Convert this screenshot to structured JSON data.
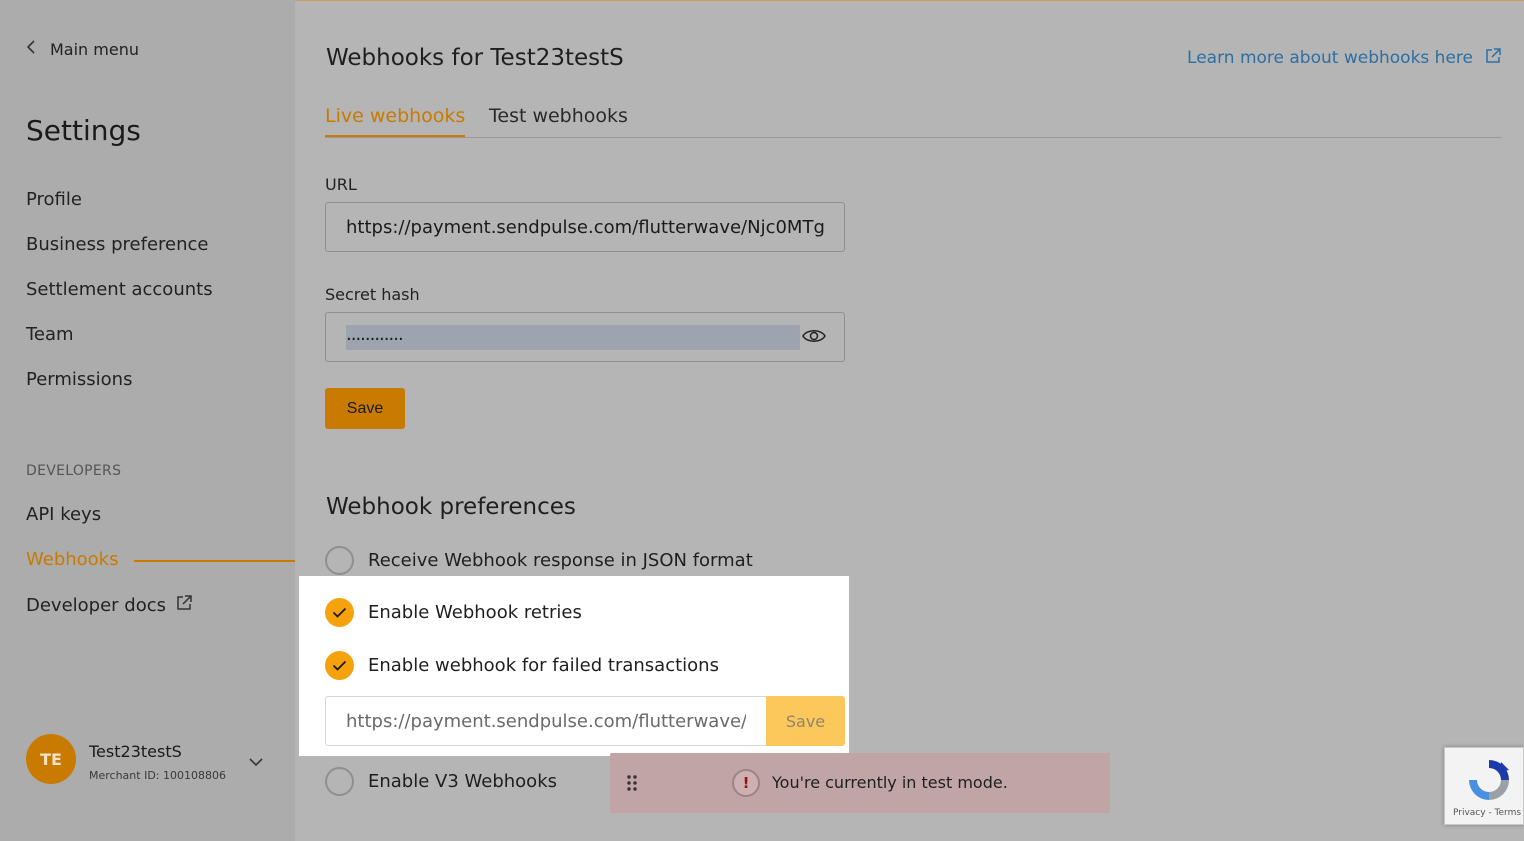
{
  "sidebar": {
    "back_label": "Main menu",
    "title": "Settings",
    "items": [
      {
        "label": "Profile"
      },
      {
        "label": "Business preference"
      },
      {
        "label": "Settlement accounts"
      },
      {
        "label": "Team"
      },
      {
        "label": "Permissions"
      }
    ],
    "developers_section": "DEVELOPERS",
    "dev_items": [
      {
        "label": "API keys"
      },
      {
        "label": "Webhooks"
      },
      {
        "label": "Developer docs"
      }
    ],
    "user": {
      "initials": "TE",
      "name": "Test23testS",
      "merchant_id": "Merchant ID: 100108806"
    }
  },
  "main": {
    "title": "Webhooks for Test23testS",
    "learn_more": "Learn more about webhooks here",
    "tabs": [
      {
        "label": "Live webhooks",
        "active": true
      },
      {
        "label": "Test webhooks",
        "active": false
      }
    ],
    "url_label": "URL",
    "url_value": "https://payment.sendpulse.com/flutterwave/Njc0MTg",
    "secret_label": "Secret hash",
    "secret_value": "............",
    "save_label": "Save",
    "preferences_title": "Webhook preferences",
    "preferences": [
      {
        "label": "Receive Webhook response in JSON format",
        "checked": false
      },
      {
        "label": "Enable Webhook retries",
        "checked": true
      },
      {
        "label": "Enable webhook for failed transactions",
        "checked": true
      },
      {
        "label": "Enable V3 Webhooks",
        "checked": false
      }
    ],
    "failed_url_value": "https://payment.sendpulse.com/flutterwave/",
    "failed_save_label": "Save"
  },
  "toast": {
    "icon": "!",
    "message": "You're currently in test mode."
  },
  "recaptcha": {
    "links": "Privacy - Terms"
  },
  "colors": {
    "accent": "#c97a00",
    "check": "#f5a20c",
    "link": "#2d6fa3"
  }
}
